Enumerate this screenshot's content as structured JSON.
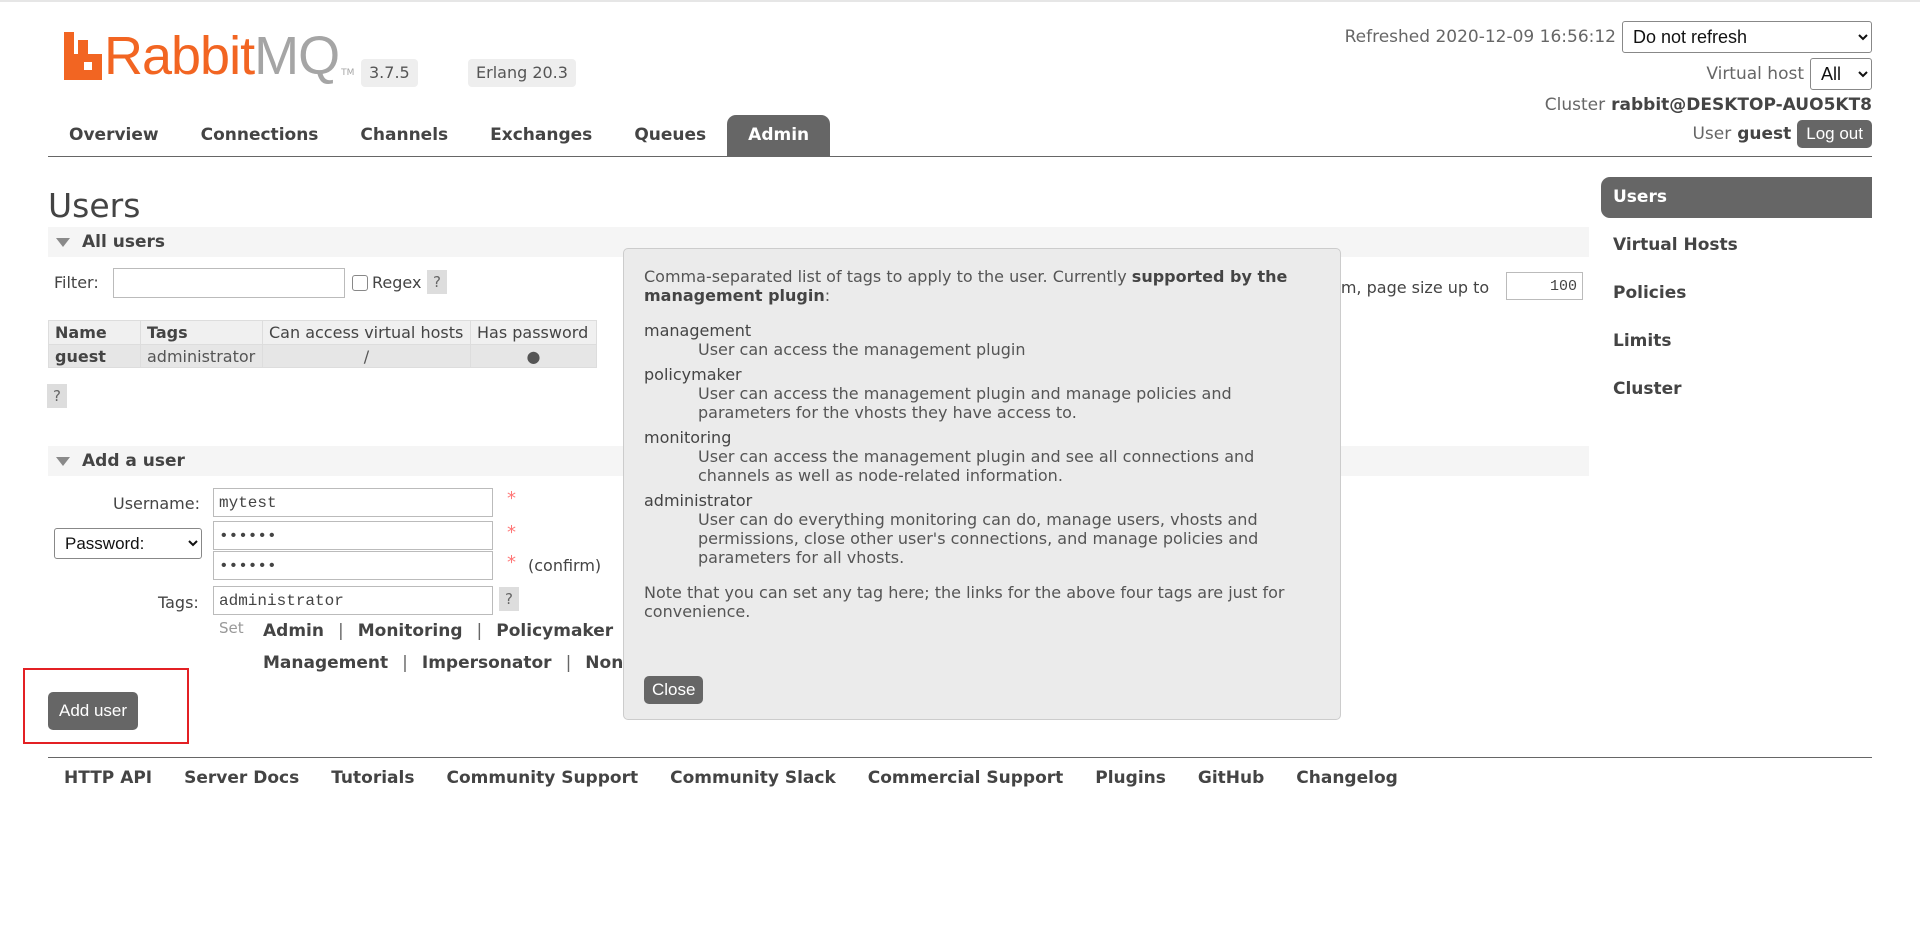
{
  "header": {
    "logo": {
      "rabbit": "Rabbit",
      "mq": "MQ",
      "tm": "TM"
    },
    "version": "3.7.5",
    "erlang": "Erlang 20.3",
    "refreshed_label": "Refreshed 2020-12-09 16:56:12",
    "refresh_select": "Do not refresh",
    "vhost_label": "Virtual host",
    "vhost_select": "All",
    "cluster_label": "Cluster",
    "cluster_name": "rabbit@DESKTOP-AUO5KT8",
    "user_label": "User",
    "user_name": "guest",
    "logout": "Log out"
  },
  "nav": {
    "tabs": [
      "Overview",
      "Connections",
      "Channels",
      "Exchanges",
      "Queues",
      "Admin"
    ],
    "active": "Admin"
  },
  "sidebar": {
    "items": [
      "Users",
      "Virtual Hosts",
      "Policies",
      "Limits",
      "Cluster"
    ],
    "active": "Users"
  },
  "main": {
    "title": "Users",
    "all_users": {
      "heading": "All users",
      "filter_label": "Filter:",
      "filter_value": "",
      "regex_label": "Regex",
      "help": "?",
      "pagination_text": "em, page size up to",
      "page_size": "100",
      "columns": [
        "Name",
        "Tags",
        "Can access virtual hosts",
        "Has password"
      ],
      "rows": [
        {
          "name": "guest",
          "tags": "administrator",
          "vhosts": "/",
          "has_password": "●"
        }
      ]
    },
    "add_user": {
      "heading": "Add a user",
      "username_label": "Username:",
      "username_value": "mytest",
      "password_select": "Password:",
      "password_value": "••••••",
      "confirm_value": "••••••",
      "confirm_label": "(confirm)",
      "required": "*",
      "tags_label": "Tags:",
      "tags_value": "administrator",
      "set_label": "Set",
      "tag_links_row1": [
        "Admin",
        "Monitoring",
        "Policymaker"
      ],
      "tag_links_row2": [
        "Management",
        "Impersonator",
        "None"
      ],
      "separator": "|",
      "submit": "Add user"
    }
  },
  "help_popup": {
    "intro": "Comma-separated list of tags to apply to the user. Currently ",
    "intro_bold": "supported by the management plugin",
    "intro_end": ":",
    "tags": [
      {
        "name": "management",
        "desc": "User can access the management plugin"
      },
      {
        "name": "policymaker",
        "desc": "User can access the management plugin and manage policies and parameters for the vhosts they have access to."
      },
      {
        "name": "monitoring",
        "desc": "User can access the management plugin and see all connections and channels as well as node-related information."
      },
      {
        "name": "administrator",
        "desc": "User can do everything monitoring can do, manage users, vhosts and permissions, close other user's connections, and manage policies and parameters for all vhosts."
      }
    ],
    "note": "Note that you can set any tag here; the links for the above four tags are just for convenience.",
    "close": "Close"
  },
  "footer": {
    "links": [
      "HTTP API",
      "Server Docs",
      "Tutorials",
      "Community Support",
      "Community Slack",
      "Commercial Support",
      "Plugins",
      "GitHub",
      "Changelog"
    ]
  },
  "colors": {
    "brand_orange": "#f26522",
    "brand_grey": "#a5a5a5",
    "nav_active": "#666666",
    "highlight_box": "#e32024"
  }
}
